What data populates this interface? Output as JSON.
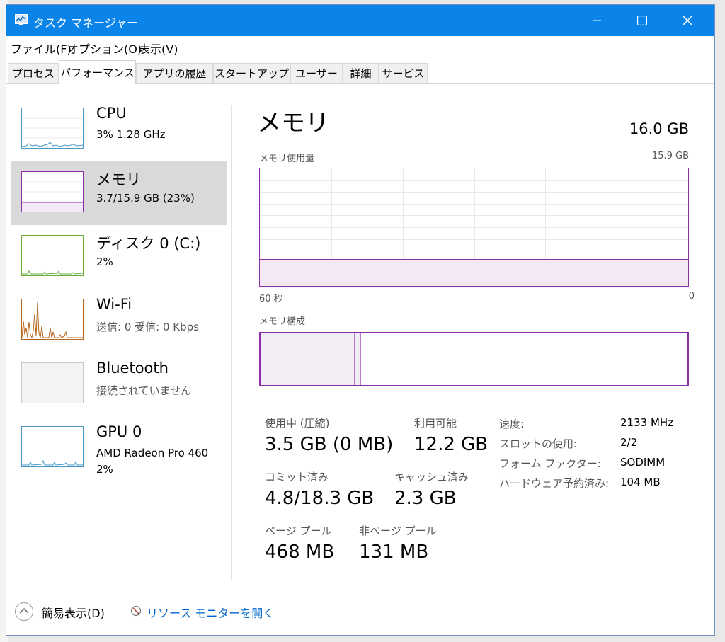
{
  "window": {
    "title": "タスク マネージャー"
  },
  "menu": [
    "ファイル(F)",
    "オプション(O)",
    "表示(V)"
  ],
  "tabs": [
    {
      "label": "プロセス"
    },
    {
      "label": "パフォーマンス"
    },
    {
      "label": "アプリの履歴"
    },
    {
      "label": "スタートアップ"
    },
    {
      "label": "ユーザー"
    },
    {
      "label": "詳細"
    },
    {
      "label": "サービス"
    }
  ],
  "active_tab": "パフォーマンス",
  "sidebar": {
    "items": [
      {
        "name": "CPU",
        "sub": "3%  1.28 GHz",
        "sub2": ""
      },
      {
        "name": "メモリ",
        "sub": "3.7/15.9 GB (23%)",
        "sub2": ""
      },
      {
        "name": "ディスク 0 (C:)",
        "sub": "2%",
        "sub2": ""
      },
      {
        "name": "Wi-Fi",
        "sub": "送信: 0  受信: 0 Kbps",
        "sub2": ""
      },
      {
        "name": "Bluetooth",
        "sub": "接続されていません",
        "sub2": ""
      },
      {
        "name": "GPU 0",
        "sub": "AMD Radeon Pro 460",
        "sub2": "2%"
      }
    ]
  },
  "detail": {
    "title": "メモリ",
    "total": "16.0 GB",
    "usage_label": "メモリ使用量",
    "usage_max": "15.9 GB",
    "axis_left": "60 秒",
    "axis_right": "0",
    "composition_label": "メモリ構成",
    "composition": {
      "in_use_fraction": 0.219,
      "modified_fraction": 0.016,
      "standby_fraction": 0.13
    },
    "usage_fraction": 0.23,
    "stats": {
      "in_use_label": "使用中 (圧縮)",
      "in_use_value": "3.5 GB (0 MB)",
      "available_label": "利用可能",
      "available_value": "12.2 GB",
      "committed_label": "コミット済み",
      "committed_value": "4.8/18.3 GB",
      "cached_label": "キャッシュ済み",
      "cached_value": "2.3 GB",
      "paged_label": "ページ プール",
      "paged_value": "468 MB",
      "nonpaged_label": "非ページ プール",
      "nonpaged_value": "131 MB"
    },
    "props": [
      {
        "label": "速度:",
        "value": "2133 MHz"
      },
      {
        "label": "スロットの使用:",
        "value": "2/2"
      },
      {
        "label": "フォーム ファクター:",
        "value": "SODIMM"
      },
      {
        "label": "ハードウェア予約済み:",
        "value": "104 MB"
      }
    ]
  },
  "footer": {
    "fewer_details": "簡易表示(D)",
    "resource_monitor": "リソース モニターを開く"
  },
  "colors": {
    "titlebar": "#0a84e8",
    "memory": "#8b2fa8",
    "cpu": "#4c98c8",
    "disk": "#6aab3c",
    "wifi": "#b5651d",
    "link": "#0066cc"
  }
}
